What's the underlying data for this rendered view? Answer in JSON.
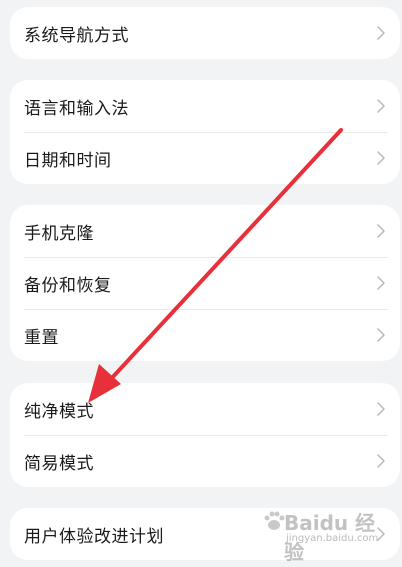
{
  "groups": [
    {
      "items": [
        {
          "label": "系统导航方式"
        }
      ]
    },
    {
      "items": [
        {
          "label": "语言和输入法"
        },
        {
          "label": "日期和时间"
        }
      ]
    },
    {
      "items": [
        {
          "label": "手机克隆"
        },
        {
          "label": "备份和恢复"
        },
        {
          "label": "重置"
        }
      ]
    },
    {
      "items": [
        {
          "label": "纯净模式"
        },
        {
          "label": "简易模式"
        }
      ]
    },
    {
      "items": [
        {
          "label": "用户体验改进计划"
        }
      ]
    }
  ],
  "annotation": {
    "color": "#e8303a",
    "icon": "red-arrow-icon"
  },
  "watermark": {
    "title": "Baidu 经验",
    "url": "jingyan.baidu.com"
  },
  "colors": {
    "background": "#f1f3f5",
    "card": "#ffffff",
    "text": "#1a1a1a",
    "chevron": "#b8b8b8"
  }
}
